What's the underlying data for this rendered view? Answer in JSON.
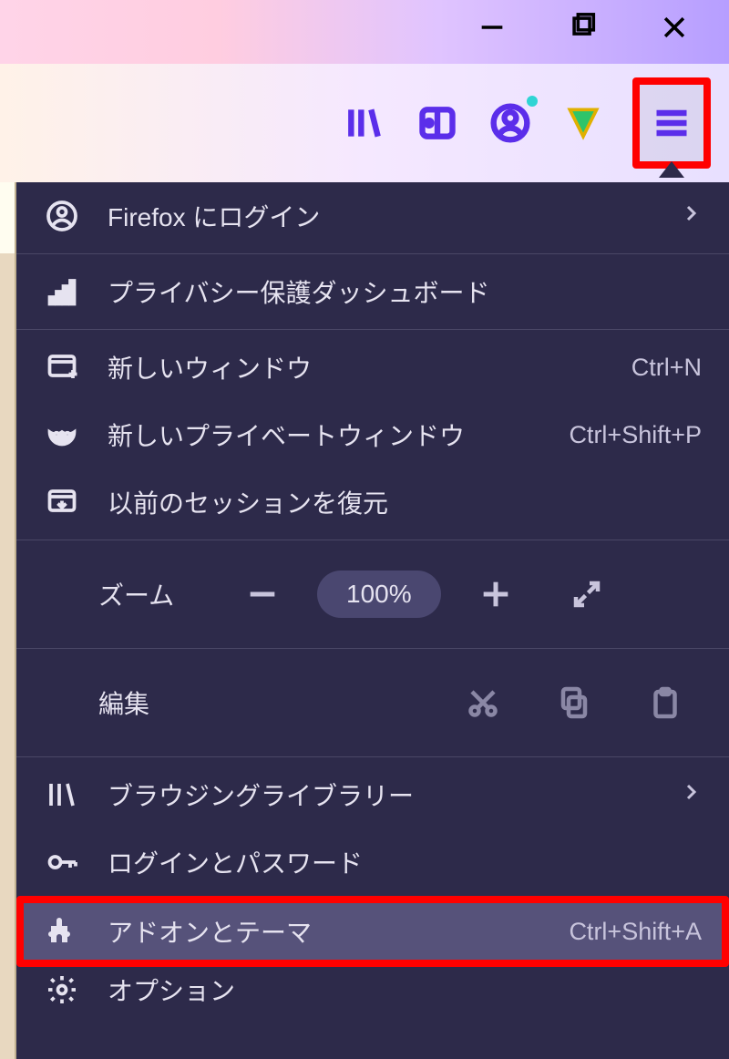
{
  "menu": {
    "signin": "Firefox にログイン",
    "privacy": "プライバシー保護ダッシュボード",
    "new_window": "新しいウィンドウ",
    "new_window_key": "Ctrl+N",
    "new_private": "新しいプライベートウィンドウ",
    "new_private_key": "Ctrl+Shift+P",
    "restore": "以前のセッションを復元",
    "zoom_label": "ズーム",
    "zoom_pct": "100%",
    "edit_label": "編集",
    "library": "ブラウジングライブラリー",
    "logins": "ログインとパスワード",
    "addons": "アドオンとテーマ",
    "addons_key": "Ctrl+Shift+A",
    "options": "オプション"
  }
}
